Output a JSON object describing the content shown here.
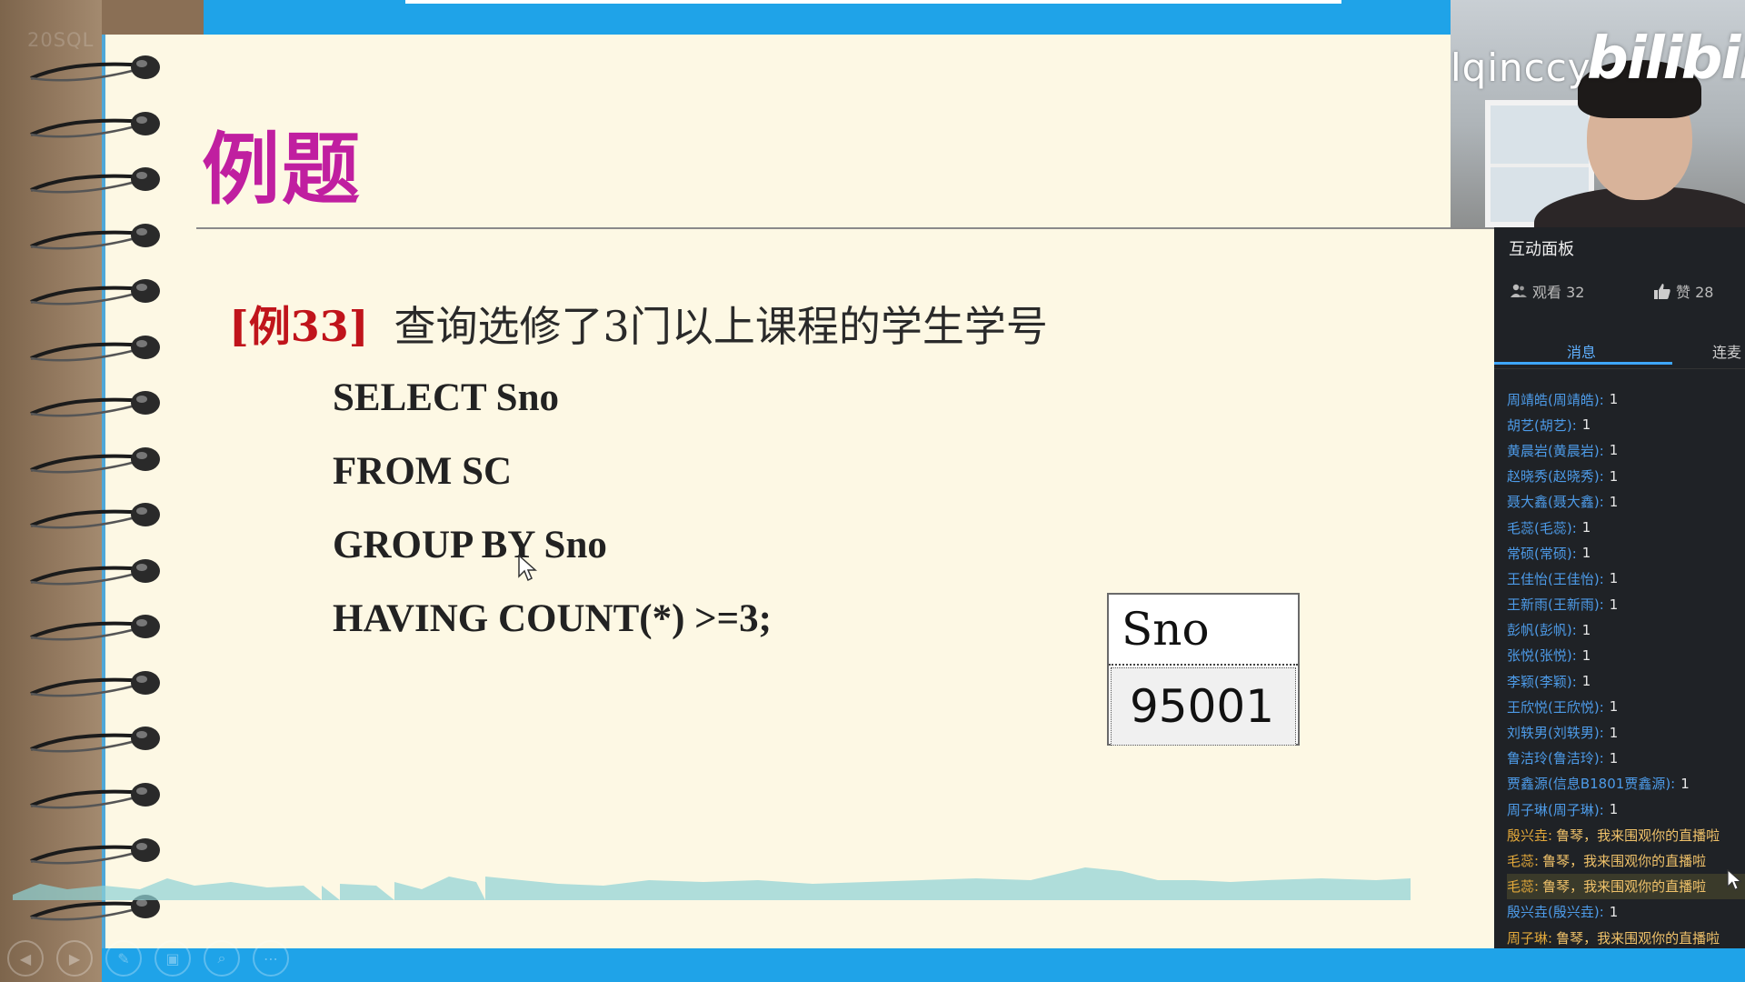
{
  "video": {
    "header_title": "20SQL",
    "watermark_user": "lqinccy",
    "watermark_logo": "bilibili"
  },
  "slide": {
    "title": "例题",
    "example_tag": "[例33]",
    "example_text": "查询选修了3门以上课程的学生学号",
    "code_lines": [
      "SELECT Sno",
      "FROM SC",
      "GROUP BY Sno",
      "HAVING COUNT(*) >=3;"
    ],
    "result_header": "Sno",
    "result_value": "95001"
  },
  "panel": {
    "title": "互动面板",
    "watch_label": "观看 32",
    "like_label": "赞 28",
    "tab_messages": "消息",
    "tab_lianmai": "连麦",
    "accent": "#3ea6ff",
    "messages": [
      {
        "name": "周靖皓(周靖皓):",
        "value": "1",
        "kind": "vote"
      },
      {
        "name": "胡艺(胡艺):",
        "value": "1",
        "kind": "vote"
      },
      {
        "name": "黄晨岩(黄晨岩):",
        "value": "1",
        "kind": "vote"
      },
      {
        "name": "赵晓秀(赵晓秀):",
        "value": "1",
        "kind": "vote"
      },
      {
        "name": "聂大鑫(聂大鑫):",
        "value": "1",
        "kind": "vote"
      },
      {
        "name": "毛蕊(毛蕊):",
        "value": "1",
        "kind": "vote"
      },
      {
        "name": "常硕(常硕):",
        "value": "1",
        "kind": "vote"
      },
      {
        "name": "王佳怡(王佳怡):",
        "value": "1",
        "kind": "vote"
      },
      {
        "name": "王新雨(王新雨):",
        "value": "1",
        "kind": "vote"
      },
      {
        "name": "彭帆(彭帆):",
        "value": "1",
        "kind": "vote"
      },
      {
        "name": "张悦(张悦):",
        "value": "1",
        "kind": "vote"
      },
      {
        "name": "李颖(李颖):",
        "value": "1",
        "kind": "vote"
      },
      {
        "name": "王欣悦(王欣悦):",
        "value": "1",
        "kind": "vote"
      },
      {
        "name": "刘轶男(刘轶男):",
        "value": "1",
        "kind": "vote"
      },
      {
        "name": "鲁洁玲(鲁洁玲):",
        "value": "1",
        "kind": "vote"
      },
      {
        "name": "贾鑫源(信息B1801贾鑫源):",
        "value": "1",
        "kind": "vote"
      },
      {
        "name": "周子琳(周子琳):",
        "value": "1",
        "kind": "vote"
      },
      {
        "name": "殷兴垚:",
        "value": "鲁琴，我来围观你的直播啦",
        "kind": "chat"
      },
      {
        "name": "毛蕊:",
        "value": "鲁琴，我来围观你的直播啦",
        "kind": "chat"
      },
      {
        "name": "毛蕊:",
        "value": "鲁琴，我来围观你的直播啦",
        "kind": "chat-hl"
      },
      {
        "name": "殷兴垚(殷兴垚):",
        "value": "1",
        "kind": "vote"
      },
      {
        "name": "周子琳:",
        "value": "鲁琴，我来围观你的直播啦",
        "kind": "chat"
      }
    ]
  }
}
